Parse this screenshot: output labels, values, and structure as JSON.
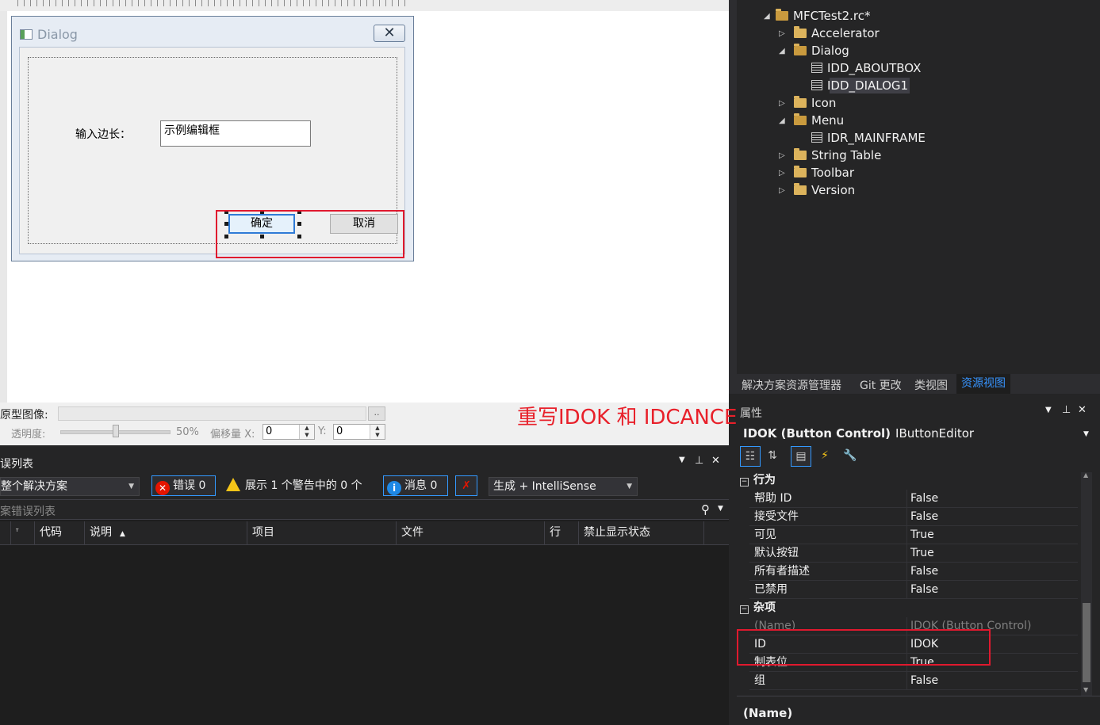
{
  "dialog": {
    "title": "Dialog",
    "close_glyph": "✕",
    "static_label": "输入边长：",
    "edit_text": "示例编辑框",
    "ok_label": "确定",
    "cancel_label": "取消"
  },
  "image_bar": {
    "prototype_label": "原型图像:",
    "browse_label": "..",
    "opacity_label": "透明度:",
    "opacity_value": "50%",
    "offset_label": "偏移量 X:",
    "offset_x": "0",
    "y_label": "Y:",
    "offset_y": "0",
    "opacity_fraction": 0.5
  },
  "annotation": "重写IDOK 和 IDCANCEL",
  "error_list": {
    "title": "误列表",
    "scope": "整个解决方案",
    "errors": "错误 0",
    "warnings": "展示 1 个警告中的 0 个",
    "messages": "消息 0",
    "build_filter": "生成 + IntelliSense",
    "search_placeholder": "案错误列表",
    "columns": [
      "代码",
      "说明",
      "项目",
      "文件",
      "行",
      "禁止显示状态"
    ],
    "sort_glyph": "▲"
  },
  "solution_tree": {
    "root": "MFCTest2.rc*",
    "items": [
      {
        "label": "Accelerator",
        "expander": "▷"
      },
      {
        "label": "Dialog",
        "expander": "◢"
      },
      {
        "label": "IDD_ABOUTBOX"
      },
      {
        "label": "IDD_DIALOG1"
      },
      {
        "label": "Icon",
        "expander": "▷"
      },
      {
        "label": "Menu",
        "expander": "◢"
      },
      {
        "label": "IDR_MAINFRAME"
      },
      {
        "label": "String Table",
        "expander": "▷"
      },
      {
        "label": "Toolbar",
        "expander": "▷"
      },
      {
        "label": "Version",
        "expander": "▷"
      }
    ],
    "tabs": [
      "解决方案资源管理器",
      "Git 更改",
      "类视图",
      "资源视图"
    ]
  },
  "properties": {
    "title": "属性",
    "object_name": "IDOK (Button Control)",
    "object_editor": "IButtonEditor",
    "categories": [
      {
        "name": "行为",
        "toggle": "−"
      },
      {
        "name": "杂项",
        "toggle": "−"
      }
    ],
    "behavior_rows": [
      {
        "name": "帮助 ID",
        "value": "False"
      },
      {
        "name": "接受文件",
        "value": "False"
      },
      {
        "name": "可见",
        "value": "True"
      },
      {
        "name": "默认按钮",
        "value": "True"
      },
      {
        "name": "所有者描述",
        "value": "False"
      },
      {
        "name": "已禁用",
        "value": "False"
      }
    ],
    "misc_rows": [
      {
        "name": "(Name)",
        "value": "IDOK (Button Control)"
      },
      {
        "name": "ID",
        "value": "IDOK"
      },
      {
        "name": "制表位",
        "value": "True"
      },
      {
        "name": "组",
        "value": "False"
      }
    ],
    "description_name": "(Name)"
  },
  "colors": {
    "annotation_red": "#e8202a",
    "highlight_box": "#e0192e",
    "active_tab": "#3794ff",
    "folder": "#dcb35c"
  }
}
